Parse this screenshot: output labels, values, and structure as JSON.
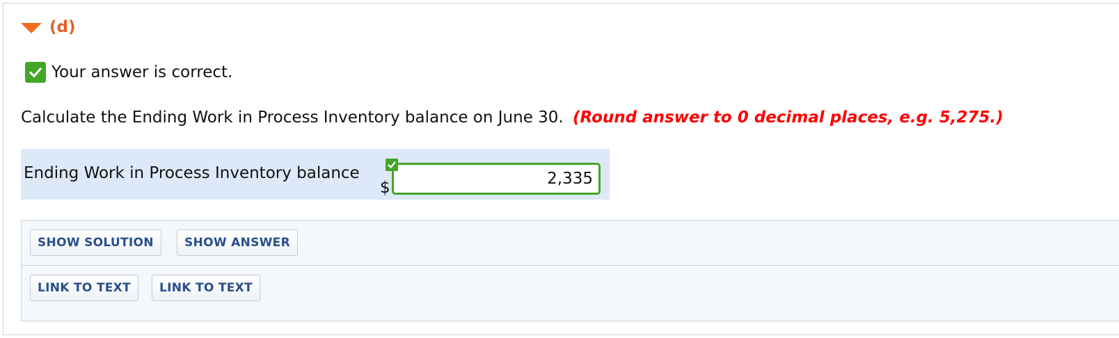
{
  "part": {
    "label": "(d)"
  },
  "status": {
    "text": "Your answer is correct."
  },
  "question": {
    "text": "Calculate the Ending Work in Process Inventory balance on June 30.",
    "hint": "(Round answer to 0 decimal places, e.g. 5,275.)"
  },
  "answer": {
    "label": "Ending Work in Process Inventory balance",
    "currency": "$",
    "value": "2,335"
  },
  "tools": {
    "show_solution": "SHOW SOLUTION",
    "show_answer": "SHOW ANSWER",
    "link_to_text_1": "LINK TO TEXT",
    "link_to_text_2": "LINK TO TEXT"
  },
  "colors": {
    "accent_orange": "#e0612a",
    "correct_green": "#43a626",
    "hint_red": "#ff0000",
    "button_text_blue": "#2a4f8a",
    "answer_row_bg": "#dde8f8"
  }
}
